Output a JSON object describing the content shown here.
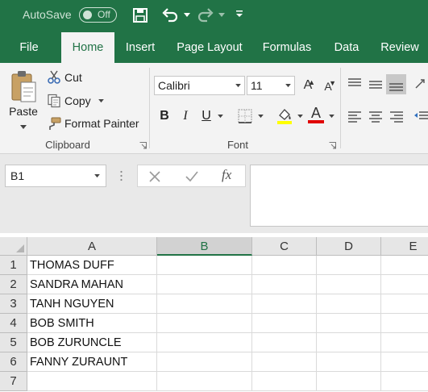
{
  "titlebar": {
    "autosave_label": "AutoSave",
    "autosave_state": "Off"
  },
  "tabs": [
    {
      "label": "File"
    },
    {
      "label": "Home",
      "active": true
    },
    {
      "label": "Insert"
    },
    {
      "label": "Page Layout"
    },
    {
      "label": "Formulas"
    },
    {
      "label": "Data"
    },
    {
      "label": "Review"
    }
  ],
  "ribbon": {
    "clipboard": {
      "paste_label": "Paste",
      "cut_label": "Cut",
      "copy_label": "Copy",
      "format_painter_label": "Format Painter",
      "group_label": "Clipboard"
    },
    "font": {
      "font_name": "Calibri",
      "font_size": "11",
      "group_label": "Font",
      "bold_label": "B",
      "italic_label": "I",
      "underline_label": "U",
      "font_color_label": "A",
      "grow_label": "A",
      "shrink_label": "A"
    }
  },
  "formula_bar": {
    "name_box": "B1",
    "fx_label": "fx",
    "content": ""
  },
  "colors": {
    "brand": "#217346",
    "highlight": "#ffff00",
    "font_color": "#e00000"
  },
  "grid": {
    "columns": [
      "A",
      "B",
      "C",
      "D",
      "E"
    ],
    "rows": [
      {
        "num": "1",
        "a": "THOMAS DUFF"
      },
      {
        "num": "2",
        "a": "SANDRA MAHAN"
      },
      {
        "num": "3",
        "a": "TANH NGUYEN"
      },
      {
        "num": "4",
        "a": "BOB SMITH"
      },
      {
        "num": "5",
        "a": "BOB ZURUNCLE"
      },
      {
        "num": "6",
        "a": "FANNY ZURAUNT"
      },
      {
        "num": "7",
        "a": ""
      }
    ],
    "active_cell": "B1"
  }
}
